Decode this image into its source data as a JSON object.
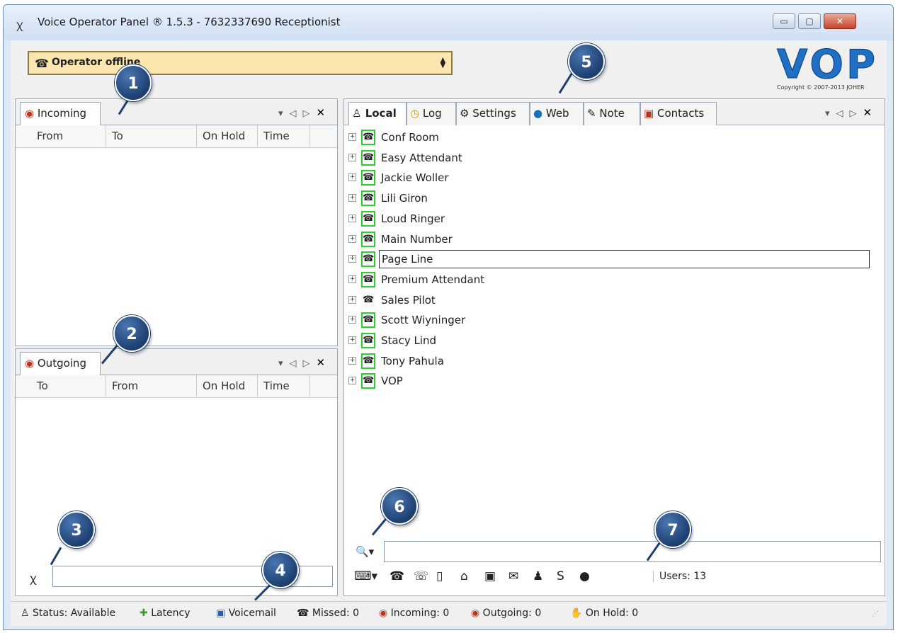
{
  "window": {
    "title": "Voice Operator Panel ® 1.5.3 - 7632337690 Receptionist",
    "app_icon": "ꭓ",
    "controls": {
      "minimize": "▭",
      "maximize": "▢",
      "close": "✕"
    }
  },
  "operator_status": {
    "text": "Operator offline",
    "icon": "telephone-icon"
  },
  "logo": {
    "text": "VOP",
    "copyright": "Copyright © 2007-2013 JOHER"
  },
  "incoming_panel": {
    "tab_label": "Incoming",
    "columns": [
      "From",
      "To",
      "On Hold",
      "Time"
    ],
    "controls": {
      "menu": "▾",
      "prev": "◁",
      "next": "▷",
      "close": "✕"
    }
  },
  "outgoing_panel": {
    "tab_label": "Outgoing",
    "columns": [
      "To",
      "From",
      "On Hold",
      "Time"
    ],
    "controls": {
      "menu": "▾",
      "prev": "◁",
      "next": "▷",
      "close": "✕"
    },
    "dial_icon": "ꭓ",
    "dial_value": ""
  },
  "right_panel": {
    "tabs": [
      {
        "label": "Local",
        "icon": "user-icon",
        "glyph": "👤"
      },
      {
        "label": "Log",
        "icon": "clock-icon",
        "glyph": "◷"
      },
      {
        "label": "Settings",
        "icon": "settings-icon",
        "glyph": "⚙"
      },
      {
        "label": "Web",
        "icon": "globe-icon",
        "glyph": "●"
      },
      {
        "label": "Note",
        "icon": "note-icon",
        "glyph": "✎"
      },
      {
        "label": "Contacts",
        "icon": "contacts-icon",
        "glyph": "▣"
      }
    ],
    "controls": {
      "menu": "▾",
      "prev": "◁",
      "next": "▷",
      "close": "✕"
    },
    "extensions": [
      {
        "label": "Conf Room",
        "online": true
      },
      {
        "label": "Easy Attendant",
        "online": true
      },
      {
        "label": "Jackie Woller",
        "online": true
      },
      {
        "label": "Lili Giron",
        "online": true
      },
      {
        "label": "Loud Ringer",
        "online": true
      },
      {
        "label": "Main Number",
        "online": true
      },
      {
        "label": "Page Line",
        "online": true,
        "selected": true
      },
      {
        "label": "Premium Attendant",
        "online": true
      },
      {
        "label": "Sales Pilot",
        "online": false
      },
      {
        "label": "Scott Wiyninger",
        "online": true
      },
      {
        "label": "Stacy Lind",
        "online": true
      },
      {
        "label": "Tony Pahula",
        "online": true
      },
      {
        "label": "VOP",
        "online": true
      }
    ],
    "search": {
      "icon": "🔍▾",
      "value": ""
    },
    "toolbar_icons": [
      {
        "name": "keyboard-dropdown-icon",
        "glyph": "⌨▾"
      },
      {
        "name": "transfer-icon",
        "glyph": "☎"
      },
      {
        "name": "phone-icon",
        "glyph": "☏"
      },
      {
        "name": "mobile-icon",
        "glyph": "▯"
      },
      {
        "name": "home-icon",
        "glyph": "⌂"
      },
      {
        "name": "voicemail-icon",
        "glyph": "▣"
      },
      {
        "name": "message-icon",
        "glyph": "✉"
      },
      {
        "name": "user-group-icon",
        "glyph": "♟"
      },
      {
        "name": "skype-icon",
        "glyph": "S"
      },
      {
        "name": "globe-icon",
        "glyph": "●"
      }
    ],
    "users_label": "Users: 13"
  },
  "status_bar": {
    "status": "Status: Available",
    "latency": "Latency",
    "voicemail": "Voicemail",
    "missed": "Missed: 0",
    "incoming": "Incoming: 0",
    "outgoing": "Outgoing: 0",
    "on_hold": "On Hold: 0"
  },
  "callouts": [
    "1",
    "2",
    "3",
    "4",
    "5",
    "6",
    "7"
  ],
  "colors": {
    "accent": "#1f6fc4",
    "callout": "#1c3f70",
    "online_border": "#2fce2f",
    "status_box": "#fce6b0"
  }
}
